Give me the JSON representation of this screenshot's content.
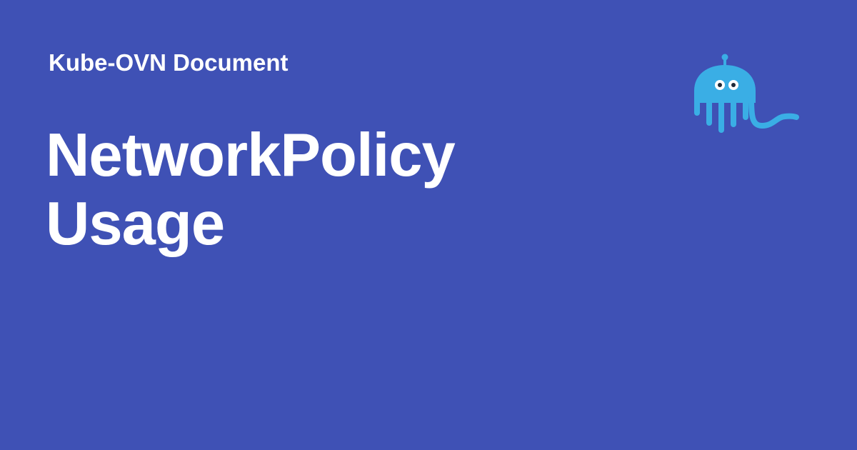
{
  "site": {
    "name": "Kube-OVN Document"
  },
  "page": {
    "title_lines": [
      "NetworkPolicy",
      "Usage"
    ]
  },
  "logo": {
    "icon": "kube-ovn-octopus-icon"
  },
  "colors": {
    "background": "#3f51b5",
    "text": "#ffffff",
    "logo_body": "#3aaee5"
  }
}
